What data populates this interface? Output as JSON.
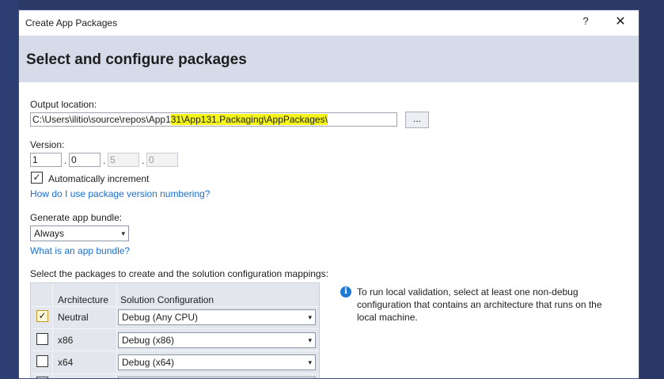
{
  "window": {
    "title": "Create App Packages",
    "help_label": "?",
    "close_label": "✕"
  },
  "header": {
    "title": "Select and configure packages"
  },
  "output": {
    "label": "Output location:",
    "value_prefix": "C:\\Users\\ilitio\\source\\repos\\App1",
    "value_highlight": "31\\App131.Packaging\\AppPackages\\",
    "browse_label": "..."
  },
  "version": {
    "label": "Version:",
    "major": "1",
    "minor": "0",
    "build": "5",
    "revision": "0",
    "separator": "."
  },
  "auto_increment": {
    "label": "Automatically increment",
    "checked": true,
    "check_glyph": "✓"
  },
  "version_help_link": "How do I use package version numbering?",
  "bundle": {
    "label": "Generate app bundle:",
    "selected": "Always",
    "arrow": "▾"
  },
  "bundle_help_link": "What is an app bundle?",
  "packages": {
    "label": "Select the packages to create and the solution configuration mappings:",
    "columns": [
      "Architecture",
      "Solution Configuration"
    ],
    "rows": [
      {
        "arch": "Neutral",
        "config": "Debug (Any CPU)",
        "checked": true,
        "check_glyph": "✓"
      },
      {
        "arch": "x86",
        "config": "Debug (x86)",
        "checked": false,
        "check_glyph": ""
      },
      {
        "arch": "x64",
        "config": "Debug (x64)",
        "checked": false,
        "check_glyph": ""
      }
    ]
  },
  "info": {
    "icon": "i",
    "text": "To run local validation, select at least one non-debug configuration that contains an architecture that runs on the local machine."
  },
  "colors": {
    "highlight": "#f5f51a",
    "link": "#1a6fd0",
    "header_bg": "#d6dbe9",
    "accent_check": "#f5c842"
  }
}
